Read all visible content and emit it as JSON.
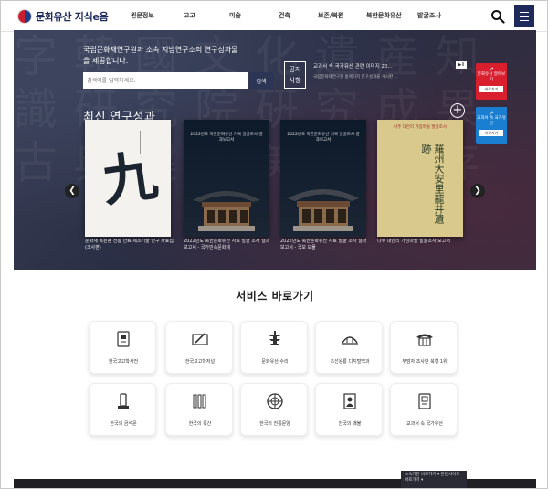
{
  "header": {
    "logo_text": "문화유산 지식e음",
    "nav": [
      "원문정보",
      "고고",
      "미술",
      "건축",
      "보존/복원",
      "북한문화유산",
      "발굴조사"
    ]
  },
  "hero": {
    "intro": "국립문화재연구원과 소속 지방연구소의 연구성과물을 제공합니다.",
    "search_placeholder": "검색어를 입력하세요.",
    "search_button": "검색",
    "notice_label": "공지\n사항",
    "notice_title": "교과서 속 국가유산 관련 이미지 20...",
    "notice_sub": "국립문화재연구원 홈페이지 연구성과물 게시판 ...",
    "notice_control": "▶II",
    "section_title": "최신 연구성과",
    "plus": "+",
    "books": [
      {
        "caption": "문화재 복원용 전통 안료 제조기술 연구 자료집(조사편)",
        "title": "",
        "hanja": "九"
      },
      {
        "caption": "2022년도 북한문화유산 자료 발굴 조사 결과보고서 - 국가민속문화재",
        "title": "2022년도 북한문화유산 기록 발굴조사 결과보고서",
        "hanja": ""
      },
      {
        "caption": "2022년도 북한문화유산 자료 발굴 조사 결과보고서 - 국보 보물",
        "title": "2022년도 북한문화유산 기록 발굴조사 결과보고서",
        "hanja": ""
      },
      {
        "caption": "나주 대안리 가암마을 발굴조사 보고서",
        "title": "나주 대안리 가암마을 발굴조사",
        "hanja": "羅州大安里龍井遺跡"
      }
    ]
  },
  "quick_links": [
    {
      "label": "문화유산 알아보기",
      "button": "바로가기"
    },
    {
      "label": "교과서 속 국가유산",
      "button": "바로가기"
    }
  ],
  "services": {
    "title": "서비스 바로가기",
    "items": [
      {
        "label": "한국고고학사전",
        "icon": "book-icon"
      },
      {
        "label": "한국고고학저널",
        "icon": "brush-icon"
      },
      {
        "label": "문화유산 수리",
        "icon": "pagoda-icon"
      },
      {
        "label": "조선왕릉 디지털백과",
        "icon": "dome-icon"
      },
      {
        "label": "무덤자 조사단 북형 1위",
        "icon": "hanok-icon"
      },
      {
        "label": "한국의 금석문",
        "icon": "stele-icon"
      },
      {
        "label": "한국의 목간",
        "icon": "wood-slips-icon"
      },
      {
        "label": "한국의 전통문양",
        "icon": "pattern-icon"
      },
      {
        "label": "한국의 괘불",
        "icon": "painting-icon"
      },
      {
        "label": "교과서 속 국가유산",
        "icon": "textbook-icon"
      }
    ]
  },
  "footer": {
    "popup": "소속기관 바로가기 ▾ 관련사이트 바로가기 ▾"
  }
}
